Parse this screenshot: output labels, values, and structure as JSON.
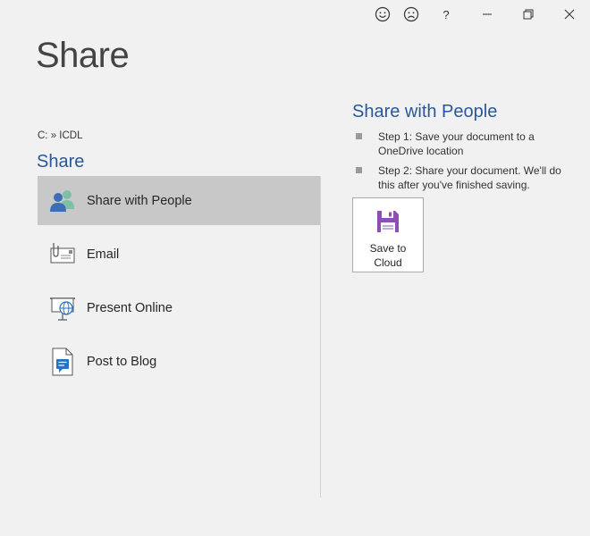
{
  "window": {
    "controls": [
      {
        "name": "smile-feedback-icon"
      },
      {
        "name": "frown-feedback-icon"
      },
      {
        "name": "help-icon",
        "label": "?"
      },
      {
        "name": "minimize-icon"
      },
      {
        "name": "restore-icon"
      },
      {
        "name": "close-icon"
      }
    ]
  },
  "page": {
    "title": "Share",
    "breadcrumb": "C: » ICDL",
    "section_title": "Share"
  },
  "menu": {
    "items": [
      {
        "label": "Share with People",
        "icon": "people-icon",
        "selected": true
      },
      {
        "label": "Email",
        "icon": "email-icon",
        "selected": false
      },
      {
        "label": "Present Online",
        "icon": "present-online-icon",
        "selected": false
      },
      {
        "label": "Post to Blog",
        "icon": "blog-icon",
        "selected": false
      }
    ]
  },
  "right_panel": {
    "title": "Share with People",
    "steps": [
      "Step 1: Save your document to a OneDrive location",
      "Step 2: Share your document. We'll do this after you've finished saving."
    ],
    "save_button": {
      "label": "Save to Cloud",
      "icon": "floppy-disk-icon",
      "accent": "#8d4fb5"
    }
  },
  "colors": {
    "background": "#f1f1f1",
    "accent_blue": "#2b579a",
    "selected_item": "#c8c8c8"
  }
}
